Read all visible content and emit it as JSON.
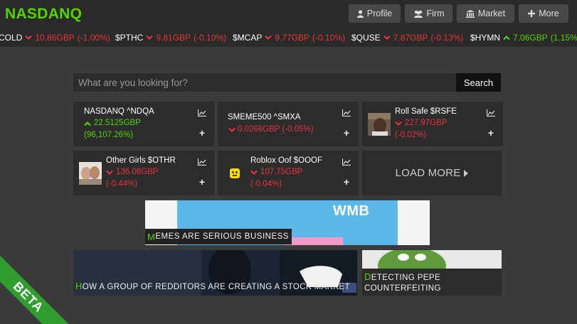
{
  "header": {
    "logo": "NASDANQ",
    "nav": [
      {
        "label": "Profile",
        "icon": "user-icon"
      },
      {
        "label": "Firm",
        "icon": "users-icon"
      },
      {
        "label": "Market",
        "icon": "bank-icon"
      },
      {
        "label": "More",
        "icon": "plus-icon"
      }
    ]
  },
  "ticker": [
    {
      "symbol": "COLD",
      "price": "10.86GBP",
      "change": "(-1.00%)",
      "dir": "down"
    },
    {
      "symbol": "$PTHC",
      "price": "9.81GBP",
      "change": "(-0.10%)",
      "dir": "down"
    },
    {
      "symbol": "$MCAP",
      "price": "9.77GBP",
      "change": "(-0.10%)",
      "dir": "down"
    },
    {
      "symbol": "$QUSE",
      "price": "7.87GBP",
      "change": "(-0.13%)",
      "dir": "down"
    },
    {
      "symbol": "$HYMN",
      "price": "7.06GBP",
      "change": "(1.15%",
      "dir": "up"
    }
  ],
  "search": {
    "placeholder": "What are you looking for?",
    "button": "Search"
  },
  "cards": [
    {
      "name": "NASDANQ ^NDQA",
      "price": "22.5125GBP",
      "change": "(96,107.26%)",
      "dir": "up"
    },
    {
      "name": "SMEME500 ^SMXA",
      "price": "0.0268GBP (-0.05%)",
      "change": "",
      "dir": "down"
    },
    {
      "name": "Roll Safe $RSFE",
      "price": "227.97GBP",
      "change": "(-0.02%)",
      "dir": "down"
    },
    {
      "name": "Other Girls $OTHR",
      "price": "136.08GBP",
      "change": "(-0.44%)",
      "dir": "down"
    },
    {
      "name": "Roblox Oof $OOOF",
      "price": "107.75GBP",
      "change": "(-0.04%)",
      "dir": "down"
    }
  ],
  "load_more": "LOAD MORE",
  "banner": {
    "brand": "WMB",
    "caption_first": "M",
    "caption_rest": "EMES ARE SERIOUS BUSINESS"
  },
  "news": [
    {
      "first": "H",
      "rest": "OW A GROUP OF REDDITORS ARE CREATING A STOCK MARKET"
    },
    {
      "first": "D",
      "rest": "ETECTING PEPE",
      "rest2": "COUNTERFEITING"
    }
  ],
  "beta": "BETA",
  "colors": {
    "accent": "#55d400",
    "negative": "#e8343a",
    "background": "#3a3a3a",
    "panel": "#2c2c2c"
  }
}
